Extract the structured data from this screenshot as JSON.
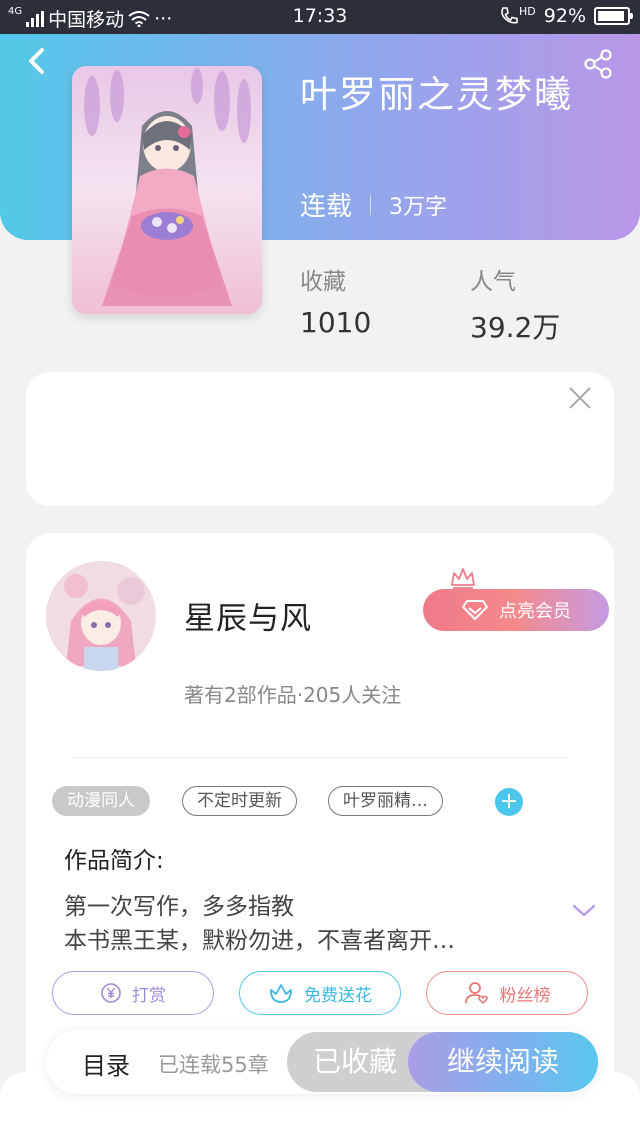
{
  "status_bar": {
    "carrier": "中国移动",
    "network": "4G",
    "extra": "···",
    "time": "17:33",
    "hd": "HD",
    "battery": "92%"
  },
  "book": {
    "title": "叶罗丽之灵梦曦",
    "status": "连载",
    "word_count": "3万字",
    "stats": [
      {
        "label": "收藏",
        "value": "1010"
      },
      {
        "label": "人气",
        "value": "39.2万"
      }
    ]
  },
  "author": {
    "name": "星辰与风",
    "meta": "著有2部作品·205人关注",
    "vip_button": "点亮会员"
  },
  "tags": [
    "动漫同人",
    "不定时更新",
    "叶罗丽精…"
  ],
  "intro": {
    "heading": "作品简介:",
    "lines": [
      "第一次写作，多多指教",
      "本书黑王某，默粉勿进，不喜者离开…"
    ]
  },
  "actions": [
    {
      "label": "打赏"
    },
    {
      "label": "免费送花"
    },
    {
      "label": "粉丝榜"
    }
  ],
  "bottom_bar": {
    "toc": "目录",
    "chapters": "已连载55章",
    "favorited": "已收藏",
    "continue": "继续阅读"
  },
  "colors": {
    "header_gradient_start": "#53c9e9",
    "header_gradient_end": "#b997e8",
    "vip_gradient_start": "#f07a8a",
    "accent_blue": "#4cc6ea"
  }
}
